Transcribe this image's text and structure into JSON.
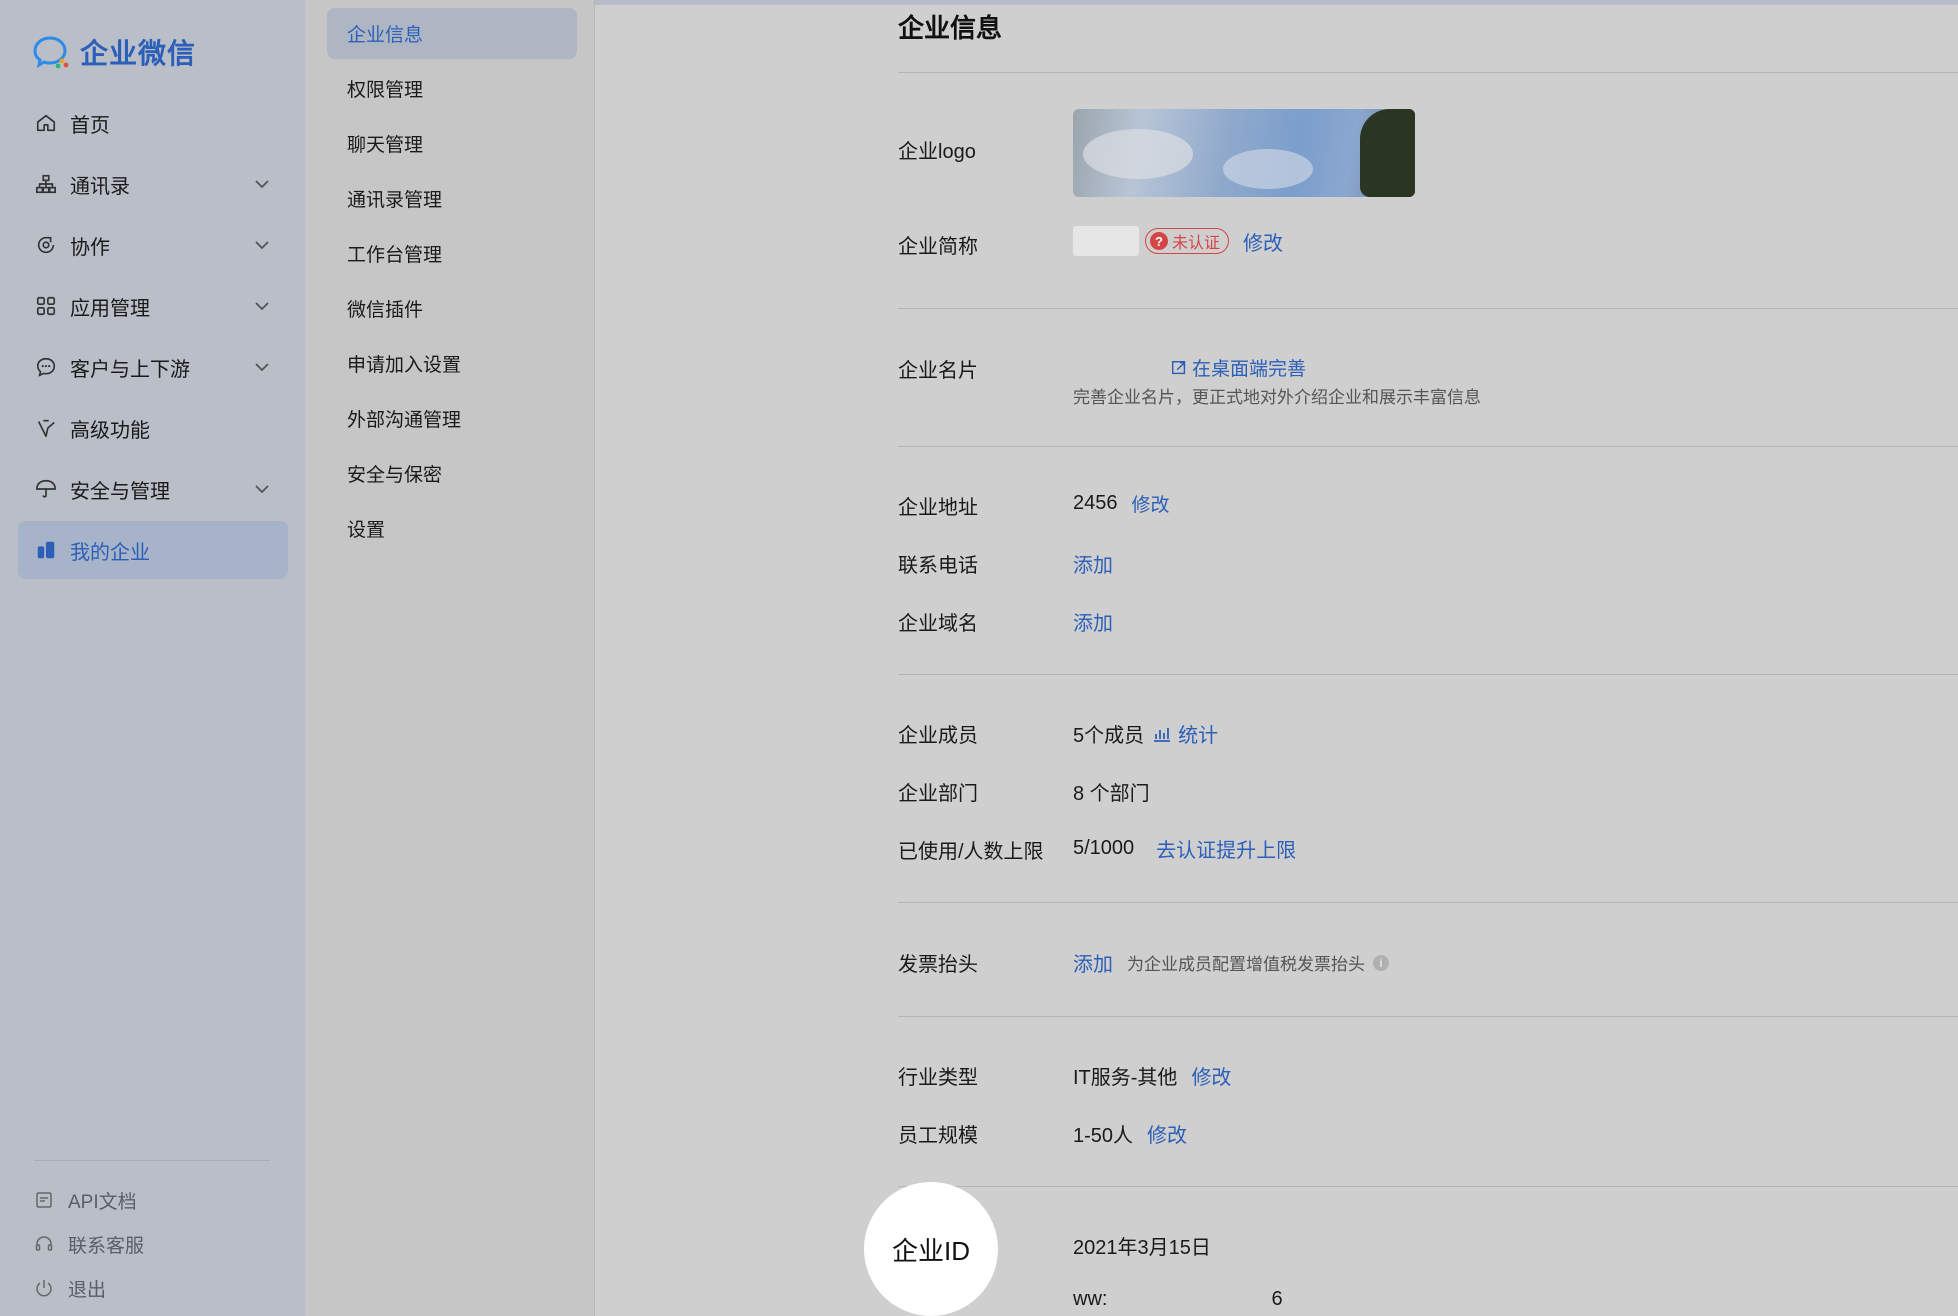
{
  "brand": {
    "name": "企业微信",
    "logo_icon": "wecom-logo-icon",
    "color": "#2c5fb8"
  },
  "nav": {
    "items": [
      {
        "label": "首页",
        "icon": "home-icon",
        "expandable": false,
        "active": false
      },
      {
        "label": "通讯录",
        "icon": "org-chart-icon",
        "expandable": true,
        "active": false
      },
      {
        "label": "协作",
        "icon": "collaboration-icon",
        "expandable": true,
        "active": false
      },
      {
        "label": "应用管理",
        "icon": "apps-grid-icon",
        "expandable": true,
        "active": false
      },
      {
        "label": "客户与上下游",
        "icon": "chat-bubble-icon",
        "expandable": true,
        "active": false
      },
      {
        "label": "高级功能",
        "icon": "advanced-icon",
        "expandable": false,
        "active": false
      },
      {
        "label": "安全与管理",
        "icon": "umbrella-icon",
        "expandable": true,
        "active": false
      },
      {
        "label": "我的企业",
        "icon": "company-icon",
        "expandable": false,
        "active": true
      }
    ],
    "bottom": [
      {
        "label": "API文档",
        "icon": "document-icon"
      },
      {
        "label": "联系客服",
        "icon": "headset-icon"
      },
      {
        "label": "退出",
        "icon": "power-icon"
      }
    ]
  },
  "submenu": {
    "items": [
      {
        "label": "企业信息",
        "active": true
      },
      {
        "label": "权限管理",
        "active": false
      },
      {
        "label": "聊天管理",
        "active": false
      },
      {
        "label": "通讯录管理",
        "active": false
      },
      {
        "label": "工作台管理",
        "active": false
      },
      {
        "label": "微信插件",
        "active": false
      },
      {
        "label": "申请加入设置",
        "active": false
      },
      {
        "label": "外部沟通管理",
        "active": false
      },
      {
        "label": "安全与保密",
        "active": false
      },
      {
        "label": "设置",
        "active": false
      }
    ]
  },
  "main": {
    "title": "企业信息",
    "logo": {
      "label": "企业logo"
    },
    "short_name": {
      "label": "企业简称",
      "badge": "未认证",
      "badge_icon": "question-icon",
      "edit": "修改"
    },
    "card": {
      "label": "企业名片",
      "link": "在桌面端完善",
      "link_icon": "external-edit-icon",
      "hint": "完善企业名片，更正式地对外介绍企业和展示丰富信息"
    },
    "address": {
      "label": "企业地址",
      "value": "2456",
      "edit": "修改"
    },
    "phone": {
      "label": "联系电话",
      "action": "添加"
    },
    "domain": {
      "label": "企业域名",
      "action": "添加"
    },
    "members": {
      "label": "企业成员",
      "value": "5个成员",
      "stats_icon": "chart-icon",
      "stats": "统计"
    },
    "departments": {
      "label": "企业部门",
      "value": "8 个部门"
    },
    "limit": {
      "label": "已使用/人数上限",
      "value": "5/1000",
      "action": "去认证提升上限"
    },
    "invoice": {
      "label": "发票抬头",
      "action": "添加",
      "hint": "为企业成员配置增值税发票抬头",
      "info_icon": "info-icon"
    },
    "industry": {
      "label": "行业类型",
      "value": "IT服务-其他",
      "edit": "修改"
    },
    "scale": {
      "label": "员工规模",
      "value": "1-50人",
      "edit": "修改"
    },
    "created": {
      "value": "2021年3月15日"
    },
    "corp_id": {
      "label": "企业ID",
      "value_prefix": "ww:",
      "value_suffix": "6"
    }
  },
  "colors": {
    "accent": "#2c5fb8",
    "warning": "#d64545"
  }
}
